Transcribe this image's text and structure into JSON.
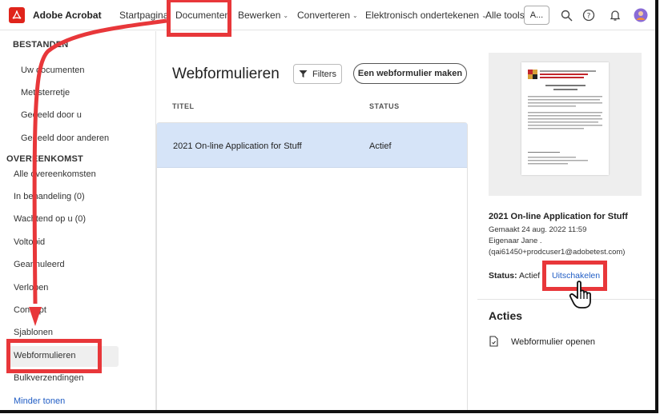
{
  "topbar": {
    "app_name": "Adobe Acrobat",
    "nav": [
      "Startpagina",
      "Documenten",
      "Bewerken",
      "Converteren",
      "Elektronisch ondertekenen",
      "Alle tools"
    ],
    "account_short": "A..."
  },
  "sidebar": {
    "section_files": "BESTANDEN",
    "files_items": [
      "Uw documenten",
      "Met sterretje",
      "Gedeeld door u",
      "Gedeeld door anderen"
    ],
    "section_agreements": "OVEREENKOMST",
    "agreement_items": [
      "Alle overeenkomsten",
      "In behandeling (0)",
      "Wachtend op u (0)",
      "Voltooid",
      "Geannuleerd",
      "Verlopen",
      "Concept",
      "Sjablonen",
      "Webformulieren",
      "Bulkverzendingen"
    ],
    "show_less": "Minder tonen"
  },
  "main": {
    "title": "Webformulieren",
    "filters_label": "Filters",
    "create_label": "Een webformulier maken",
    "col_title": "TITEL",
    "col_status": "STATUS",
    "rows": [
      {
        "title": "2021 On-line Application for Stuff",
        "status": "Actief"
      }
    ]
  },
  "details": {
    "thumbnail_text": "COLLEGE OF AGRICULTURE & NATURAL RESOURCES",
    "title": "2021 On-line Application for Stuff",
    "created": "Gemaakt 24 aug. 2022 11:59",
    "owner": "Eigenaar Jane .",
    "email": "(qai61450+prodcuser1@adobetest.com)",
    "status_label": "Status:",
    "status_value": "Actief",
    "disable_link": "Uitschakelen",
    "actions_heading": "Acties",
    "open_action": "Webformulier openen"
  },
  "colors": {
    "accent_blue": "#1f5cc4",
    "selected_row": "#d6e4f8",
    "annotation_red": "#e8373a",
    "brand_red": "#e0241b"
  }
}
